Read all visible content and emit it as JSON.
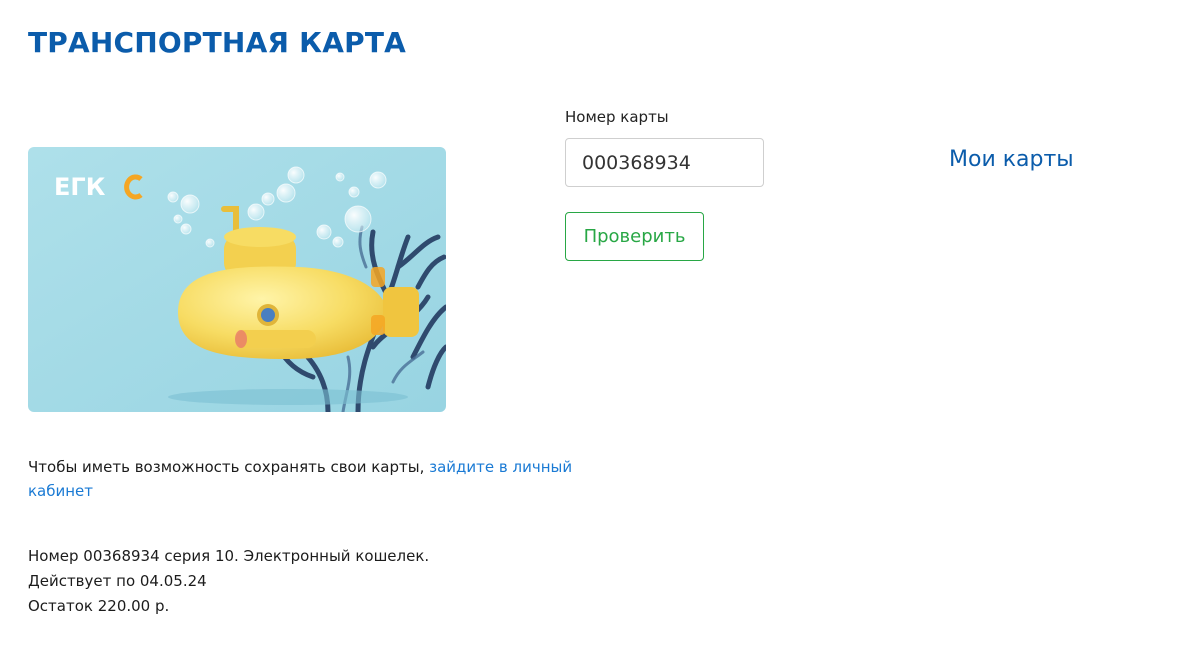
{
  "page": {
    "title": "ТРАНСПОРТНАЯ КАРТА"
  },
  "card_image": {
    "brand_logo": "ЕГКС",
    "background_color": "#a6dce8",
    "submarine_color": "#f7dc63",
    "coral_color": "#2f4a6e",
    "logo_accent_color": "#f5a623"
  },
  "form": {
    "card_number_label": "Номер карты",
    "card_number_value": "000368934",
    "submit_label": "Проверить"
  },
  "links": {
    "my_cards": "Мои карты"
  },
  "login_note": {
    "text": "Чтобы иметь возможность сохранять свои карты, ",
    "link_text": "зайдите в личный кабинет"
  },
  "card_info": {
    "line_1": "Номер 00368934 серия 10. Электронный кошелек.",
    "line_2": "Действует по 04.05.24",
    "line_3": "Остаток 220.00 р."
  },
  "colors": {
    "title": "#0b5cab",
    "link": "#1a7ad4",
    "button_accent": "#28a745"
  }
}
